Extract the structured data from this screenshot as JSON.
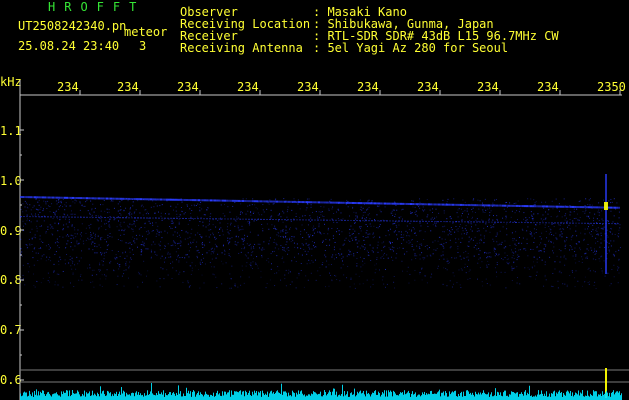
{
  "title": "HROFFT",
  "file": {
    "name": "UT2508242340.pn",
    "type": "meteor",
    "date_time": "25.08.24 23:40",
    "count": "3"
  },
  "header": {
    "labels": [
      "Observer",
      "Receiving Location",
      "Receiver",
      "Receiving Antenna"
    ],
    "values": [
      ": Masaki Kano",
      ": Shibukawa, Gunma, Japan",
      ": RTL-SDR SDR# 43dB L15 96.7MHz CW",
      ": 5el Yagi Az 280 for Seoul"
    ]
  },
  "axis": {
    "y_unit": "kHz",
    "y_ticks": [
      "1.1",
      "1.0",
      "0.9",
      "0.8",
      "0.7",
      "0.6"
    ],
    "x_ticks": [
      "234",
      "234",
      "234",
      "234",
      "234",
      "234",
      "234",
      "234",
      "234",
      "2350"
    ]
  },
  "colors": {
    "background": "#000000",
    "text": "#ffff33",
    "title": "#35e535",
    "signal": "#2a3cff",
    "echo": "#ffff00",
    "spectrum": "#00e5ff"
  }
}
